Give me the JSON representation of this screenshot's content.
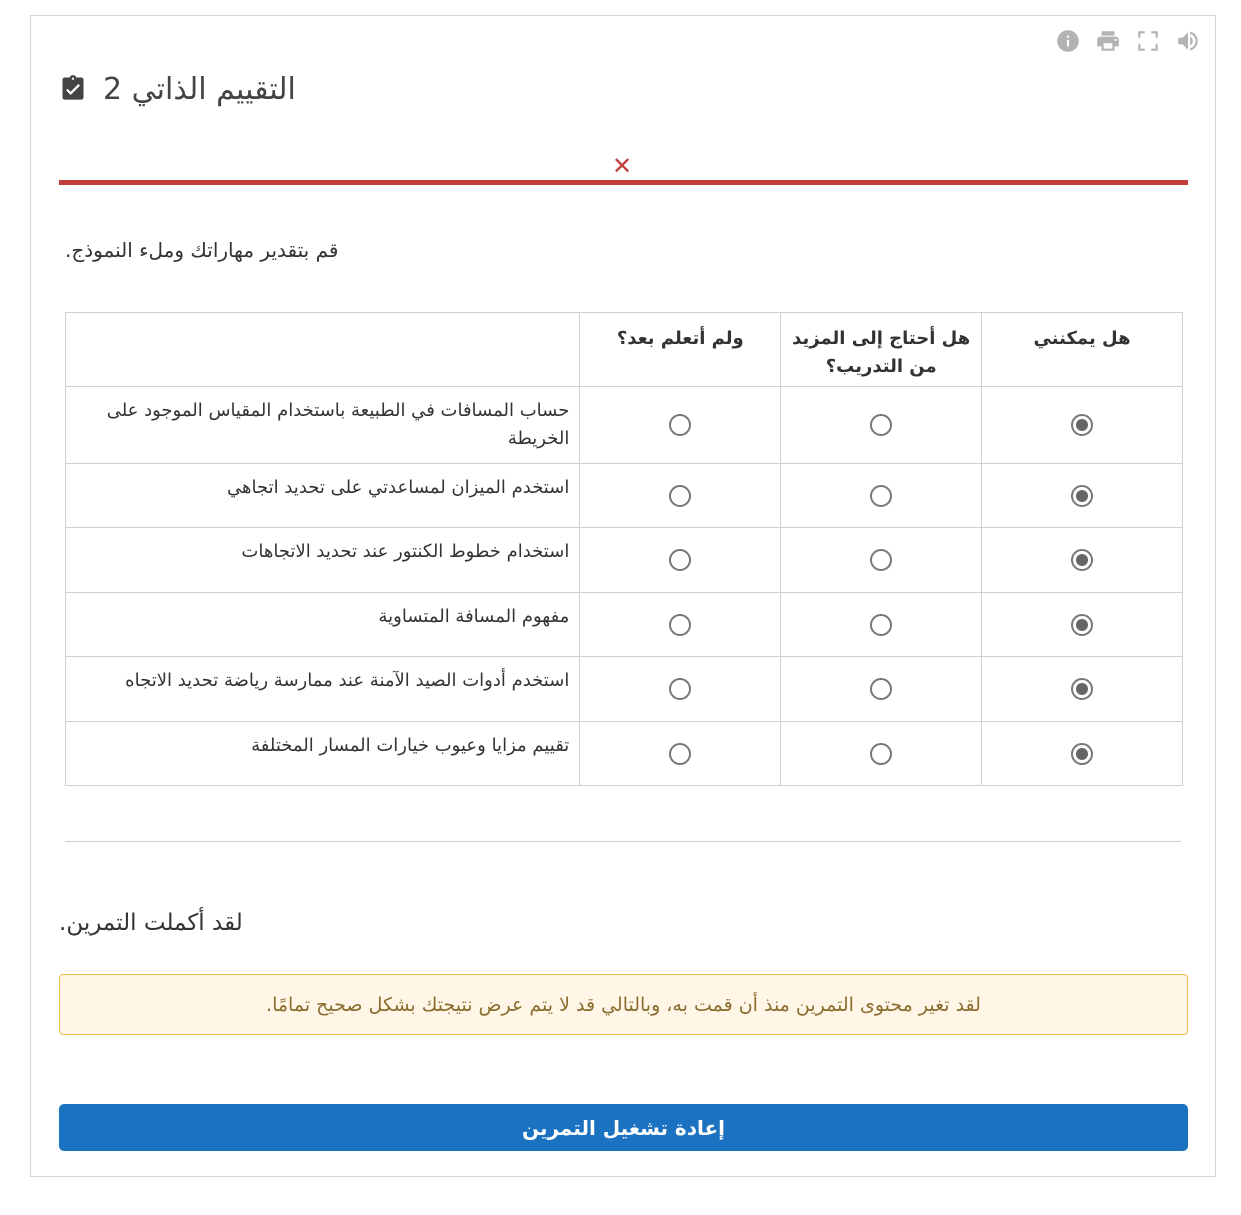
{
  "toolbar": {
    "icons": [
      "info-icon",
      "print-icon",
      "fullscreen-icon",
      "volume-icon"
    ]
  },
  "header": {
    "title": "التقييم الذاتي 2",
    "icon": "clipboard-check-icon"
  },
  "progress": {
    "status": "incorrect",
    "mark": "✕",
    "color": "#c43d3d"
  },
  "instructions": ".قم بتقدير مهاراتك وملء النموذج",
  "table": {
    "headers": {
      "can": "هل يمكنني",
      "need_more": "هل أحتاج إلى المزيد من التدريب؟",
      "not_yet": "ولم أتعلم بعد؟"
    },
    "rows": [
      {
        "statement": "حساب المسافات في الطبيعة باستخدام المقياس الموجود على الخريطة",
        "selected": "can"
      },
      {
        "statement": "استخدم الميزان لمساعدتي على تحديد اتجاهي",
        "selected": "can"
      },
      {
        "statement": "استخدام خطوط الكنتور عند تحديد الاتجاهات",
        "selected": "can"
      },
      {
        "statement": "مفهوم المسافة المتساوية",
        "selected": "can"
      },
      {
        "statement": "استخدم أدوات الصيد الآمنة عند ممارسة رياضة تحديد الاتجاه",
        "selected": "can"
      },
      {
        "statement": "تقييم مزايا وعيوب خيارات المسار المختلفة",
        "selected": "can"
      }
    ]
  },
  "completion": {
    "message": ".لقد أكملت التمرين"
  },
  "warning": {
    "message": ".لقد تغير محتوى التمرين منذ أن قمت به، وبالتالي قد لا يتم عرض نتيجتك بشكل صحيح تمامًا"
  },
  "actions": {
    "retry_label": "إعادة تشغيل التمرين"
  },
  "colors": {
    "accent": "#1a72c0",
    "error": "#c43d3d",
    "warning_bg": "#fff6e8",
    "warning_border": "#f0bd52"
  }
}
